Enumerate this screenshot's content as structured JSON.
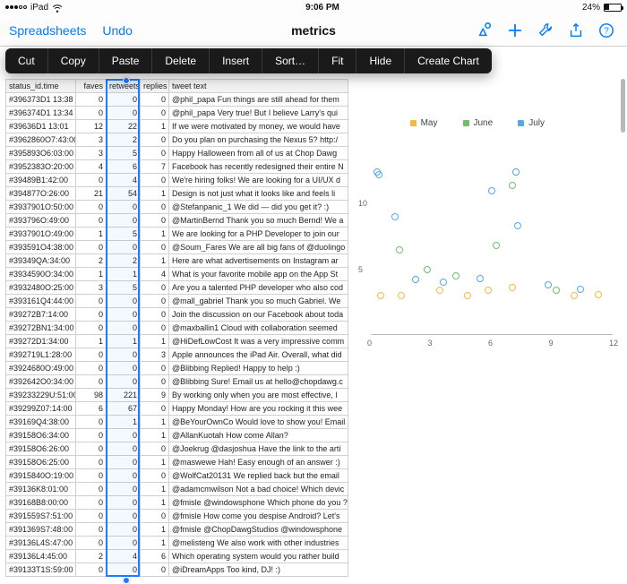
{
  "statusbar": {
    "device": "iPad",
    "time": "9:06 PM",
    "battery_pct": "24%"
  },
  "nav": {
    "back": "Spreadsheets",
    "undo": "Undo",
    "title": "metrics"
  },
  "menu": [
    "Cut",
    "Copy",
    "Paste",
    "Delete",
    "Insert",
    "Sort…",
    "Fit",
    "Hide",
    "Create Chart"
  ],
  "columns": [
    "status_id",
    "time",
    "faves",
    "retweets",
    "replies",
    "tweet text"
  ],
  "rows": [
    [
      "#396373D1",
      "13:38",
      "0",
      "0",
      "0",
      "@phil_papa Fun things are still ahead for them"
    ],
    [
      "#396374D1",
      "13:34",
      "0",
      "0",
      "0",
      "@phil_papa Very true! But I believe Larry's qui"
    ],
    [
      "#39636D1",
      "13:01",
      "12",
      "22",
      "1",
      "If we were motivated by money, we would have"
    ],
    [
      "#3962860O7:43:00",
      "",
      "3",
      "2",
      "0",
      "Do you plan on purchasing the Nexus 5? http:/"
    ],
    [
      "#395893O6:03:00",
      "",
      "3",
      "5",
      "0",
      "Happy Halloween from all of us at Chop Dawg"
    ],
    [
      "#3952383O:20:00",
      "",
      "4",
      "6",
      "7",
      "Facebook has recently redesigned their entire N"
    ],
    [
      "#39489B1:42:00",
      "",
      "0",
      "4",
      "0",
      "We're hiring folks! We are looking for a UI/UX d"
    ],
    [
      "#394877O:26:00",
      "",
      "21",
      "54",
      "1",
      "Design is not just what it looks like and feels li"
    ],
    [
      "#3937901O:50:00",
      "",
      "0",
      "0",
      "0",
      "@Stefanpanic_1 We did — did you get it? :)"
    ],
    [
      "#393796O:49:00",
      "",
      "0",
      "0",
      "0",
      "@MartinBernd Thank you so much Bernd! We a"
    ],
    [
      "#3937901O:49:00",
      "",
      "1",
      "5",
      "1",
      "We are looking for a PHP Developer to join our"
    ],
    [
      "#393591O4:38:00",
      "",
      "0",
      "0",
      "0",
      "@Soum_Fares We are all big fans of @duolingo"
    ],
    [
      "#39349QA:34:00",
      "",
      "2",
      "2",
      "1",
      "Here are what advertisements on Instagram ar"
    ],
    [
      "#3934590O:34:00",
      "",
      "1",
      "1",
      "4",
      "What is your favorite mobile app on the App St"
    ],
    [
      "#3932480O:25:00",
      "",
      "3",
      "5",
      "0",
      "Are you a talented PHP developer who also cod"
    ],
    [
      "#393161Q4:44:00",
      "",
      "0",
      "0",
      "0",
      "@mall_gabriel Thank you so much Gabriel. We"
    ],
    [
      "#39272B7:14:00",
      "",
      "0",
      "0",
      "0",
      "Join the discussion on our Facebook about toda"
    ],
    [
      "#39272BN1:34:00",
      "",
      "0",
      "0",
      "0",
      "@maxballin1 Cloud with collaboration seemed"
    ],
    [
      "#39272D1:34:00",
      "",
      "1",
      "1",
      "1",
      "@HiDefLowCost It was a very impressive comm"
    ],
    [
      "#392719L1:28:00",
      "",
      "0",
      "0",
      "3",
      "Apple announces the iPad Air. Overall, what did"
    ],
    [
      "#3924680O:49:00",
      "",
      "0",
      "0",
      "0",
      "@Blibbing Replied! Happy to help :)"
    ],
    [
      "#392642O0:34:00",
      "",
      "0",
      "0",
      "0",
      "@Blibbing Sure! Email us at hello@chopdawg.c"
    ],
    [
      "#39233229U:51:00",
      "",
      "98",
      "221",
      "9",
      "By working only when you are most effective, l"
    ],
    [
      "#39299Z07:14:00",
      "",
      "6",
      "67",
      "0",
      "Happy Monday! How are you rocking it this wee"
    ],
    [
      "#39169Q4:38:00",
      "",
      "0",
      "1",
      "1",
      "@BeYourOwnCo Would love to show you! Email"
    ],
    [
      "#39158O6:34:00",
      "",
      "0",
      "0",
      "1",
      "@AllanKuotah How come Allan?"
    ],
    [
      "#39158O6:26:00",
      "",
      "0",
      "0",
      "0",
      "@Joekrug @dasjoshua Have the link to the arti"
    ],
    [
      "#39158O6:25:00",
      "",
      "0",
      "0",
      "1",
      "@maswewe Hah! Easy enough of an answer :)"
    ],
    [
      "#3915840O:19:00",
      "",
      "0",
      "0",
      "0",
      "@WolfCat20131 We replied back but the email"
    ],
    [
      "#39136K8:01:00",
      "",
      "0",
      "0",
      "1",
      "@adamcmwilson Not a bad choice! Which devic"
    ],
    [
      "#39168B8:00:00",
      "",
      "0",
      "0",
      "1",
      "@fmisle @windowsphone Which phone do you ?"
    ],
    [
      "#391559S7:51:00",
      "",
      "0",
      "0",
      "0",
      "@fmisle How come you despise Android? Let's"
    ],
    [
      "#391369S7:48:00",
      "",
      "0",
      "0",
      "1",
      "@fmisle @ChopDawgStudios @windowsphone "
    ],
    [
      "#39136L4S:47:00",
      "",
      "0",
      "0",
      "1",
      "@melisteng We also work with other industries"
    ],
    [
      "#39136L4:45:00",
      "",
      "2",
      "4",
      "6",
      "Which operating system would you rather build"
    ],
    [
      "#39133T1S:59:00",
      "",
      "0",
      "0",
      "0",
      "@iDreamApps Too kind, DJ! :)"
    ]
  ],
  "chart_data": {
    "type": "scatter",
    "legend": [
      "May",
      "June",
      "July"
    ],
    "colors": {
      "May": "#f5b942",
      "June": "#6dc06d",
      "July": "#5aa6e6"
    },
    "x_ticks": [
      0,
      3,
      6,
      9,
      12
    ],
    "y_ticks": [
      5,
      10
    ],
    "xrange": [
      0,
      12
    ],
    "yrange": [
      0,
      15
    ],
    "points": [
      {
        "s": "July",
        "x": 0.3,
        "y": 12.4
      },
      {
        "s": "July",
        "x": 0.4,
        "y": 12.2
      },
      {
        "s": "May",
        "x": 0.5,
        "y": 3.0
      },
      {
        "s": "May",
        "x": 1.5,
        "y": 3.0
      },
      {
        "s": "June",
        "x": 1.4,
        "y": 6.5
      },
      {
        "s": "July",
        "x": 1.2,
        "y": 9.0
      },
      {
        "s": "July",
        "x": 2.2,
        "y": 4.2
      },
      {
        "s": "June",
        "x": 2.8,
        "y": 5.0
      },
      {
        "s": "May",
        "x": 3.4,
        "y": 3.4
      },
      {
        "s": "July",
        "x": 3.6,
        "y": 4.0
      },
      {
        "s": "June",
        "x": 4.2,
        "y": 4.5
      },
      {
        "s": "May",
        "x": 4.8,
        "y": 3.0
      },
      {
        "s": "July",
        "x": 5.4,
        "y": 4.3
      },
      {
        "s": "May",
        "x": 5.8,
        "y": 3.4
      },
      {
        "s": "June",
        "x": 6.2,
        "y": 6.8
      },
      {
        "s": "July",
        "x": 6.0,
        "y": 11.0
      },
      {
        "s": "May",
        "x": 7.0,
        "y": 3.6
      },
      {
        "s": "July",
        "x": 7.3,
        "y": 8.3
      },
      {
        "s": "June",
        "x": 7.0,
        "y": 11.4
      },
      {
        "s": "July",
        "x": 7.2,
        "y": 12.4
      },
      {
        "s": "July",
        "x": 8.8,
        "y": 3.8
      },
      {
        "s": "June",
        "x": 9.2,
        "y": 3.4
      },
      {
        "s": "May",
        "x": 10.1,
        "y": 3.0
      },
      {
        "s": "July",
        "x": 10.4,
        "y": 3.5
      },
      {
        "s": "May",
        "x": 11.3,
        "y": 3.1
      }
    ]
  }
}
